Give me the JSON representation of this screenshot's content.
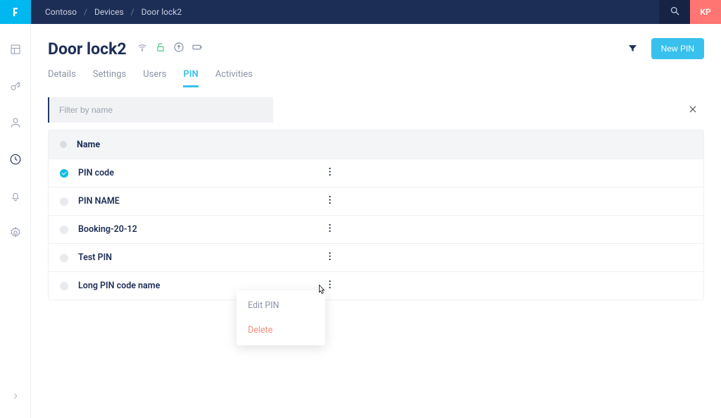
{
  "breadcrumbs": {
    "org": "Contoso",
    "section": "Devices",
    "device": "Door lock2"
  },
  "avatar": "KP",
  "page": {
    "title": "Door lock2"
  },
  "header": {
    "new_pin": "New PIN"
  },
  "tabs": {
    "details": "Details",
    "settings": "Settings",
    "users": "Users",
    "pin": "PIN",
    "activities": "Activities"
  },
  "filter": {
    "placeholder": "Filter by name"
  },
  "table": {
    "column_name": "Name",
    "rows": [
      {
        "name": "PIN code",
        "active": true
      },
      {
        "name": "PIN NAME",
        "active": false
      },
      {
        "name": "Booking-20-12",
        "active": false
      },
      {
        "name": "Test PIN",
        "active": false
      },
      {
        "name": "Long PIN code name",
        "active": false
      }
    ]
  },
  "dropdown": {
    "edit": "Edit PIN",
    "delete": "Delete"
  }
}
